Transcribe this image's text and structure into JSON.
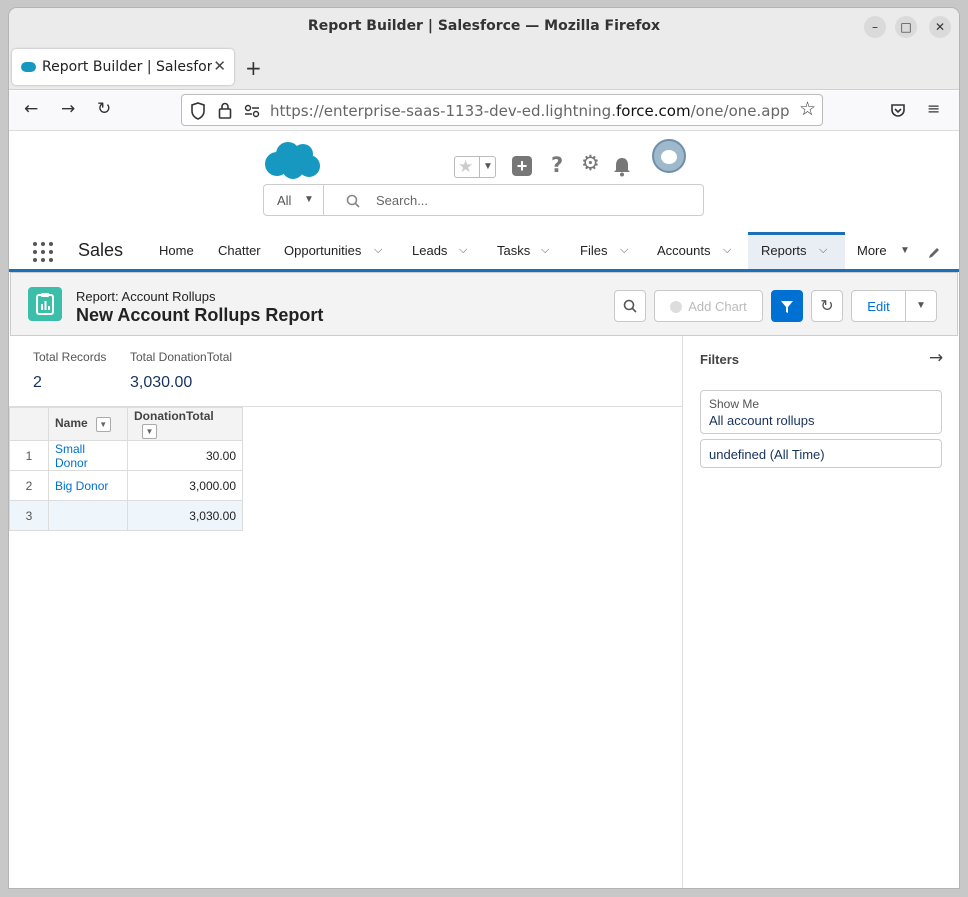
{
  "window": {
    "title": "Report Builder | Salesforce — Mozilla Firefox"
  },
  "browser": {
    "tab_label": "Report Builder | Salesforce",
    "url_prefix": "https://enterprise-saas-1133-dev-ed.lightning.",
    "url_domain": "force.com",
    "url_suffix": "/one/one.app#eyJ"
  },
  "sf": {
    "search_scope": "All",
    "search_placeholder": "Search...",
    "app_name": "Sales",
    "nav": [
      {
        "label": "Home",
        "has_menu": false
      },
      {
        "label": "Chatter",
        "has_menu": false
      },
      {
        "label": "Opportunities",
        "has_menu": true
      },
      {
        "label": "Leads",
        "has_menu": true
      },
      {
        "label": "Tasks",
        "has_menu": true
      },
      {
        "label": "Files",
        "has_menu": true
      },
      {
        "label": "Accounts",
        "has_menu": true
      },
      {
        "label": "Reports",
        "has_menu": true,
        "active": true
      },
      {
        "label": "More",
        "has_menu": true
      }
    ]
  },
  "report": {
    "type_label": "Report: Account Rollups",
    "title": "New Account Rollups Report",
    "buttons": {
      "add_chart": "Add Chart",
      "edit": "Edit"
    },
    "stats": [
      {
        "label": "Total Records",
        "value": "2"
      },
      {
        "label": "Total DonationTotal",
        "value": "3,030.00"
      }
    ],
    "columns": [
      "Name",
      "DonationTotal"
    ],
    "rows": [
      {
        "num": "1",
        "name": "Small Donor",
        "donation": "30.00"
      },
      {
        "num": "2",
        "name": "Big Donor",
        "donation": "3,000.00"
      },
      {
        "num": "3",
        "name": "",
        "donation": "3,030.00"
      }
    ]
  },
  "filters": {
    "title": "Filters",
    "show_me_label": "Show Me",
    "show_me_value": "All account rollups",
    "date_filter": "undefined (All Time)"
  },
  "colors": {
    "brand": "#0070d2",
    "nav_accent": "#1b6fb8",
    "report_icon": "#3bbfab"
  }
}
